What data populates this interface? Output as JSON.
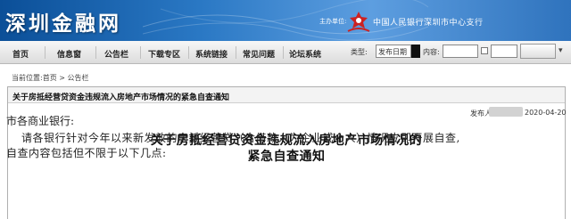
{
  "banner": {
    "site_name": "深圳金融网",
    "sponsor_label": "主办单位:",
    "sponsor_name": "中国人民银行深圳市中心支行",
    "emblem_icon": "pboc-emblem-icon",
    "colors": {
      "banner_dark": "#0b4f98",
      "banner_light": "#5d9ee0",
      "emblem": "#cc2222"
    }
  },
  "nav": {
    "items": [
      {
        "label": "首页"
      },
      {
        "label": "信息窗"
      },
      {
        "label": "公告栏"
      },
      {
        "label": "下载专区"
      },
      {
        "label": "系统链接"
      },
      {
        "label": "常见问题"
      },
      {
        "label": "论坛系统"
      }
    ],
    "search": {
      "type_label": "类型:",
      "type_value": "发布日期",
      "content_label": "内容:"
    }
  },
  "breadcrumb": {
    "prefix": "当前位置:",
    "items": [
      "首页",
      "公告栏"
    ],
    "separator": " > "
  },
  "article": {
    "header_title": "关于房抵经营贷资金违规流入房地产市场情况的紧急自查通知",
    "publisher_label": "发布人:",
    "publish_date": "2020-04-20",
    "title_lines": [
      "关于房抵经营贷资金违规流入房地产市场情况的",
      "紧急自查通知"
    ],
    "salutation": "市各商业银行:",
    "body_lines": [
      "请各银行针对今年以来新发放的房抵经营贷（含借款人为企业或个人）情况立即开展自查,",
      "自查内容包括但不限于以下几点:"
    ]
  }
}
